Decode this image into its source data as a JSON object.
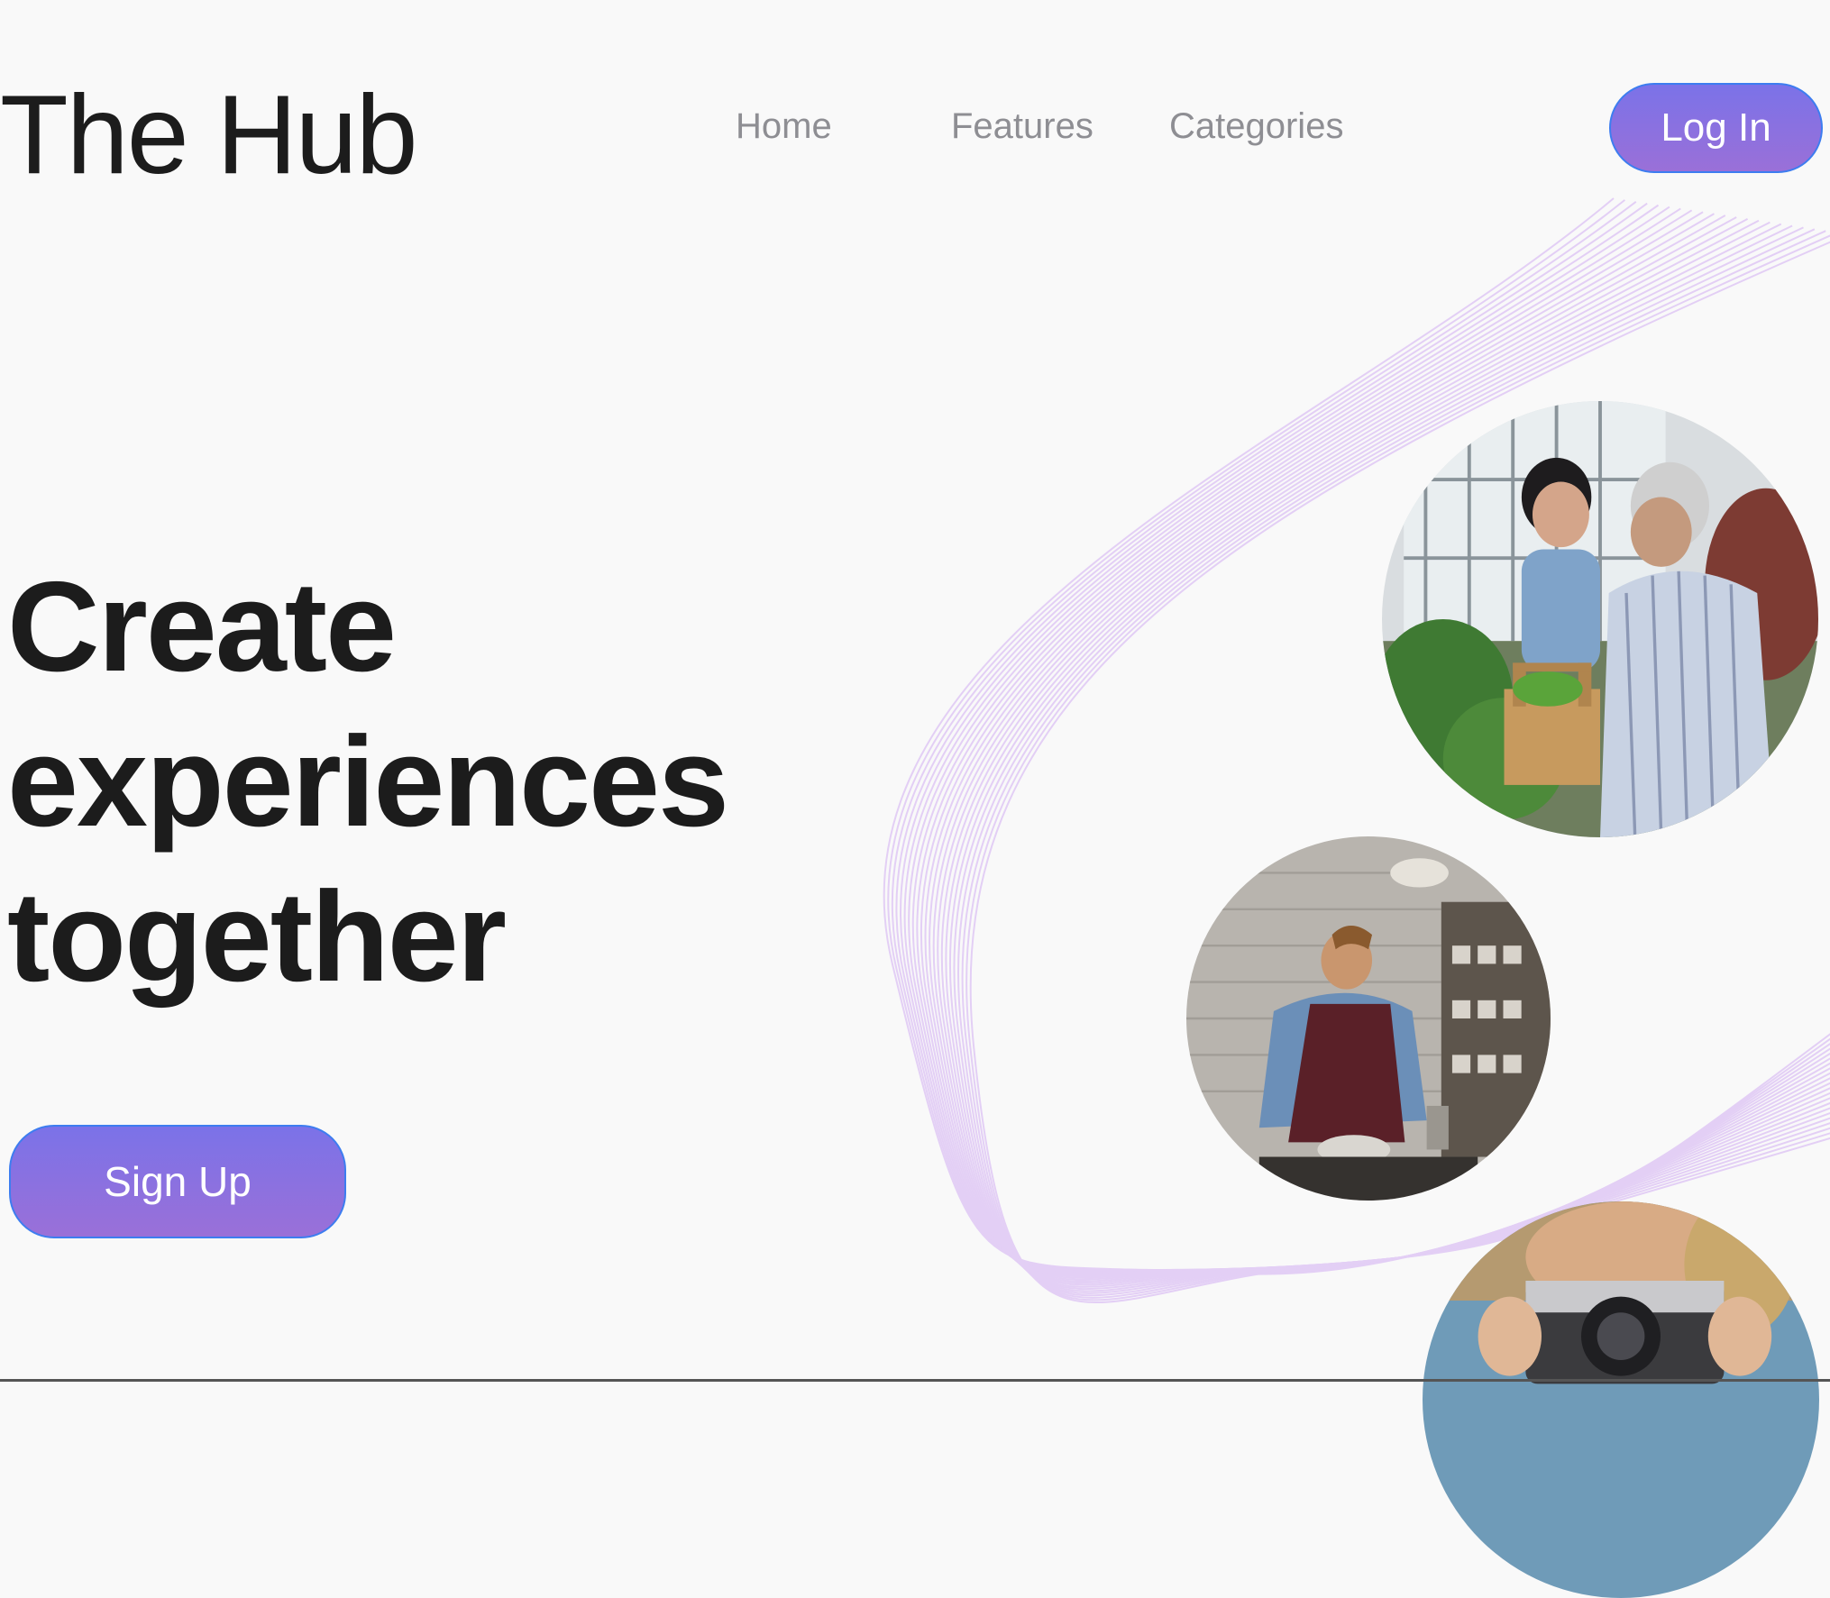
{
  "header": {
    "logo": "The Hub",
    "nav": {
      "home": "Home",
      "features": "Features",
      "categories": "Categories"
    },
    "login_label": "Log In"
  },
  "hero": {
    "title_lines": [
      "Create",
      "experiences",
      "together"
    ],
    "signup_label": "Sign Up"
  },
  "images": {
    "photo_1": "gardening-photo",
    "photo_2": "pottery-photo",
    "photo_3": "camera-photo"
  },
  "colors": {
    "accent_gradient_top": "#7b72e8",
    "accent_gradient_bottom": "#9a70d8",
    "button_border": "#3d7df0",
    "wave_lines": "#e3cff5",
    "nav_text": "#8e8e93",
    "heading_text": "#1c1c1c",
    "background": "#f9f9f9"
  }
}
